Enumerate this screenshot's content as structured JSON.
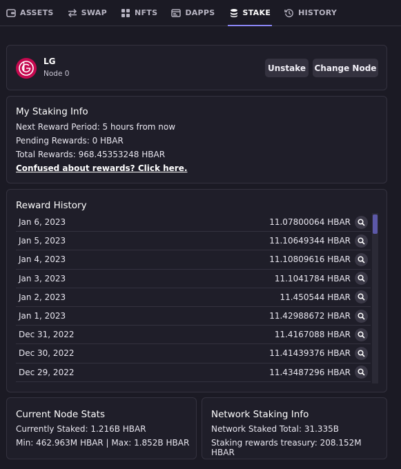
{
  "nav": {
    "items": [
      {
        "label": "ASSETS",
        "icon": "wallet-icon",
        "active": false
      },
      {
        "label": "SWAP",
        "icon": "swap-arrows-icon",
        "active": false
      },
      {
        "label": "NFTS",
        "icon": "grid-icon",
        "active": false
      },
      {
        "label": "DAPPS",
        "icon": "browser-window-icon",
        "active": false
      },
      {
        "label": "STAKE",
        "icon": "database-stack-icon",
        "active": true
      },
      {
        "label": "HISTORY",
        "icon": "history-clock-icon",
        "active": false
      }
    ]
  },
  "node": {
    "name": "LG",
    "subtitle": "Node 0",
    "logo_text": "LG",
    "unstake_label": "Unstake",
    "change_node_label": "Change Node"
  },
  "staking_info": {
    "title": "My Staking Info",
    "next_reward": "Next Reward Period: 5 hours from now",
    "pending": "Pending Rewards: 0 HBAR",
    "total": "Total Rewards: 968.45353248 HBAR",
    "help_link": "Confused about rewards? Click here."
  },
  "reward_history": {
    "title": "Reward History",
    "rows": [
      {
        "date": "Jan 6, 2023",
        "amount": "11.07800064 HBAR"
      },
      {
        "date": "Jan 5, 2023",
        "amount": "11.10649344 HBAR"
      },
      {
        "date": "Jan 4, 2023",
        "amount": "11.10809616 HBAR"
      },
      {
        "date": "Jan 3, 2023",
        "amount": "11.1041784 HBAR"
      },
      {
        "date": "Jan 2, 2023",
        "amount": "11.450544 HBAR"
      },
      {
        "date": "Jan 1, 2023",
        "amount": "11.42988672 HBAR"
      },
      {
        "date": "Dec 31, 2022",
        "amount": "11.4167088 HBAR"
      },
      {
        "date": "Dec 30, 2022",
        "amount": "11.41439376 HBAR"
      },
      {
        "date": "Dec 29, 2022",
        "amount": "11.43487296 HBAR"
      }
    ]
  },
  "node_stats": {
    "title": "Current Node Stats",
    "staked": "Currently Staked: 1.216B HBAR",
    "range": "Min: 462.963M HBAR | Max: 1.852B HBAR"
  },
  "network": {
    "title": "Network Staking Info",
    "total": "Network Staked Total: 31.335B",
    "treasury": "Staking rewards treasury: 208.152M HBAR"
  },
  "colors": {
    "background": "#1b1a24",
    "card": "#1f1e29",
    "accent": "#8a86f5",
    "logo": "#c5094f"
  }
}
